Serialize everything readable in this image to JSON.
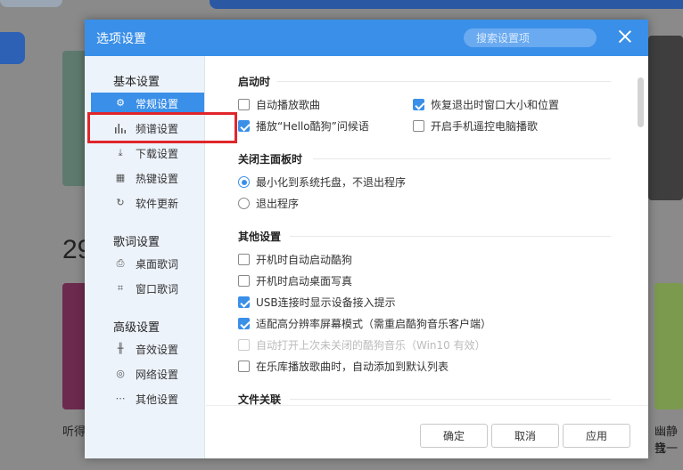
{
  "background": {
    "big_number": "29",
    "caption_left": "听得",
    "caption_right_1": "幽静音",
    "caption_right_2": "找一"
  },
  "dialog": {
    "title": "选项设置",
    "search_placeholder": "搜索设置项"
  },
  "sidebar": {
    "groups": [
      {
        "title": "基本设置",
        "items": [
          {
            "label": "常规设置",
            "icon": "gear-icon",
            "active": true
          },
          {
            "label": "频谱设置",
            "icon": "spectrum-icon"
          },
          {
            "label": "下载设置",
            "icon": "download-icon"
          },
          {
            "label": "热键设置",
            "icon": "keyboard-icon"
          },
          {
            "label": "软件更新",
            "icon": "update-icon"
          }
        ]
      },
      {
        "title": "歌词设置",
        "items": [
          {
            "label": "桌面歌词",
            "icon": "desktop-lyrics-icon"
          },
          {
            "label": "窗口歌词",
            "icon": "window-lyrics-icon"
          }
        ]
      },
      {
        "title": "高级设置",
        "items": [
          {
            "label": "音效设置",
            "icon": "equalizer-icon"
          },
          {
            "label": "网络设置",
            "icon": "network-icon"
          },
          {
            "label": "其他设置",
            "icon": "more-icon"
          }
        ]
      }
    ]
  },
  "content": {
    "startup": {
      "title": "启动时",
      "options": [
        {
          "label": "自动播放歌曲",
          "checked": false
        },
        {
          "label": "恢复退出时窗口大小和位置",
          "checked": true
        },
        {
          "label": "播放“Hello酷狗”问候语",
          "checked": true
        },
        {
          "label": "开启手机遥控电脑播歌",
          "checked": false
        }
      ]
    },
    "close_panel": {
      "title": "关闭主面板时",
      "options": [
        {
          "label": "最小化到系统托盘，不退出程序",
          "selected": true
        },
        {
          "label": "退出程序",
          "selected": false
        }
      ]
    },
    "other": {
      "title": "其他设置",
      "options": [
        {
          "label": "开机时自动启动酷狗",
          "checked": false
        },
        {
          "label": "开机时启动桌面写真",
          "checked": false
        },
        {
          "label": "USB连接时显示设备接入提示",
          "checked": true
        },
        {
          "label": "适配高分辨率屏幕模式（需重启酷狗音乐客户端）",
          "checked": true
        },
        {
          "label": "自动打开上次未关闭的酷狗音乐（Win10 有效）",
          "checked": false,
          "disabled": true
        },
        {
          "label": "在乐库播放歌曲时，自动添加到默认列表",
          "checked": false
        }
      ]
    },
    "file_assoc": {
      "title": "文件关联"
    }
  },
  "footer": {
    "ok": "确定",
    "cancel": "取消",
    "apply": "应用"
  },
  "colors": {
    "accent": "#3a8fe8",
    "highlight": "#e0262b"
  }
}
